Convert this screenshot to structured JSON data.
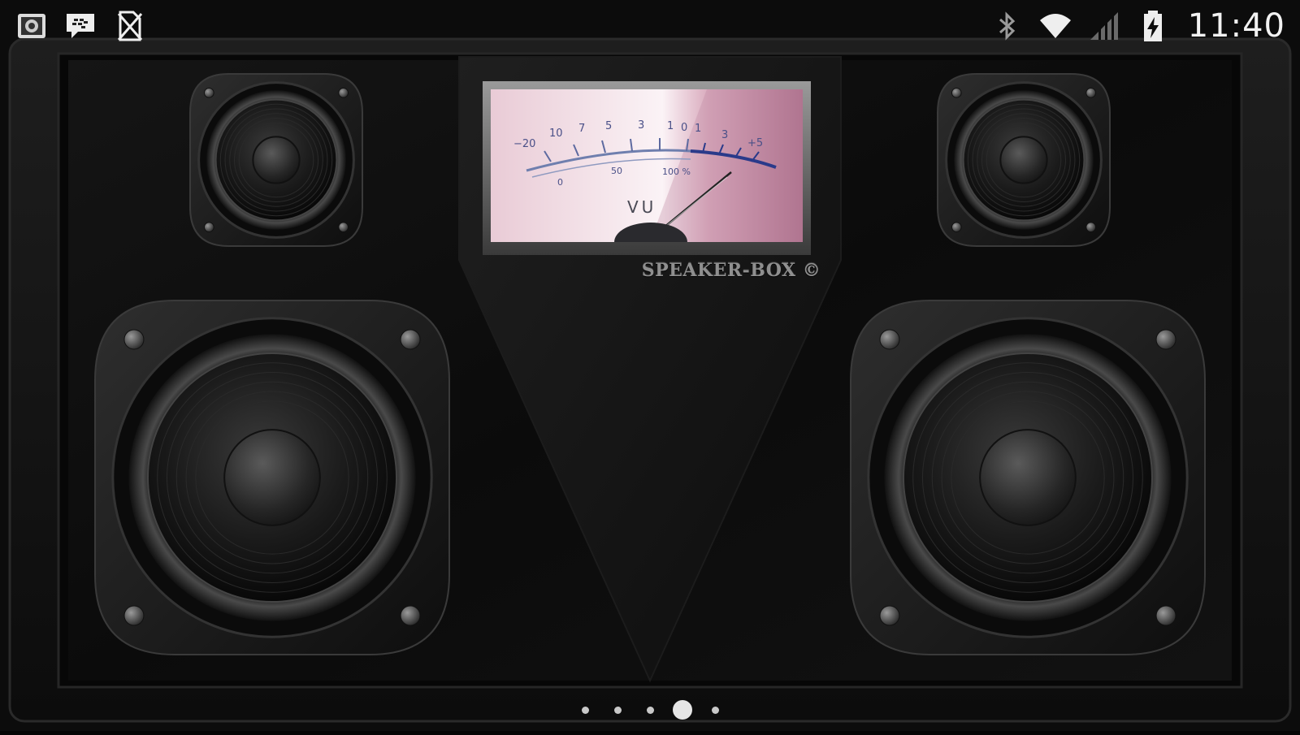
{
  "status_bar": {
    "left_icons": [
      "screenshot-icon",
      "bbm-chat-icon",
      "no-sim-icon"
    ],
    "right_icons": [
      "bluetooth-icon",
      "wifi-icon",
      "signal-icon",
      "battery-charging-icon"
    ],
    "time": "11:40"
  },
  "vu_meter": {
    "top_scale": [
      "−20",
      "10",
      "7",
      "5",
      "3",
      "1",
      "0",
      "1",
      "3",
      "+5"
    ],
    "bottom_scale": [
      "0",
      "50",
      "100 %"
    ],
    "label": "VU"
  },
  "brand": "SPEAKER-BOX ©",
  "speakers": [
    "tweeter-left",
    "tweeter-right",
    "woofer-left",
    "woofer-right"
  ],
  "page_indicator": {
    "count": 5,
    "active": 3
  },
  "colors": {
    "cabinet": "#0a0a0a",
    "meter_face": "#f3dfe6",
    "meter_scale_blue": "#2a3a8a",
    "text": "#8f8f8f"
  }
}
